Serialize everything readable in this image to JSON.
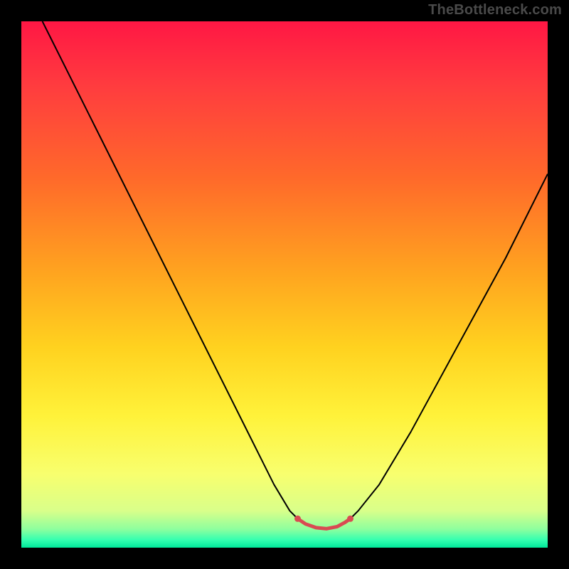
{
  "watermark": "TheBottleneck.com",
  "chart_data": {
    "type": "line",
    "title": "",
    "xlabel": "",
    "ylabel": "",
    "xlim": [
      0,
      100
    ],
    "ylim": [
      0,
      100
    ],
    "gradient_stops": [
      {
        "offset": 0.0,
        "color": "#ff1744"
      },
      {
        "offset": 0.12,
        "color": "#ff3b3f"
      },
      {
        "offset": 0.3,
        "color": "#ff6a2a"
      },
      {
        "offset": 0.48,
        "color": "#ffa51f"
      },
      {
        "offset": 0.62,
        "color": "#ffd21f"
      },
      {
        "offset": 0.75,
        "color": "#fff23a"
      },
      {
        "offset": 0.86,
        "color": "#f8ff6e"
      },
      {
        "offset": 0.93,
        "color": "#d9ff8a"
      },
      {
        "offset": 0.965,
        "color": "#8dff9e"
      },
      {
        "offset": 0.985,
        "color": "#35ffb0"
      },
      {
        "offset": 1.0,
        "color": "#00e89a"
      }
    ],
    "series": [
      {
        "name": "left-branch",
        "color": "#000000",
        "width": 2,
        "points": [
          {
            "x": 4,
            "y": 100
          },
          {
            "x": 8,
            "y": 92
          },
          {
            "x": 14,
            "y": 80
          },
          {
            "x": 20,
            "y": 68
          },
          {
            "x": 26,
            "y": 56
          },
          {
            "x": 32,
            "y": 44
          },
          {
            "x": 38,
            "y": 32
          },
          {
            "x": 44,
            "y": 20
          },
          {
            "x": 48,
            "y": 12
          },
          {
            "x": 51,
            "y": 7
          },
          {
            "x": 53,
            "y": 5
          }
        ]
      },
      {
        "name": "right-branch",
        "color": "#000000",
        "width": 2,
        "points": [
          {
            "x": 62,
            "y": 5
          },
          {
            "x": 64,
            "y": 7
          },
          {
            "x": 68,
            "y": 12
          },
          {
            "x": 74,
            "y": 22
          },
          {
            "x": 80,
            "y": 33
          },
          {
            "x": 86,
            "y": 44
          },
          {
            "x": 92,
            "y": 55
          },
          {
            "x": 98,
            "y": 67
          },
          {
            "x": 100,
            "y": 71
          }
        ]
      },
      {
        "name": "trough-highlight",
        "color": "#d94a52",
        "width": 5,
        "cap": "round",
        "points": [
          {
            "x": 52.5,
            "y": 5.5
          },
          {
            "x": 54,
            "y": 4.5
          },
          {
            "x": 56,
            "y": 3.8
          },
          {
            "x": 58,
            "y": 3.6
          },
          {
            "x": 60,
            "y": 4.0
          },
          {
            "x": 61.5,
            "y": 4.8
          },
          {
            "x": 62.5,
            "y": 5.5
          }
        ]
      }
    ]
  }
}
